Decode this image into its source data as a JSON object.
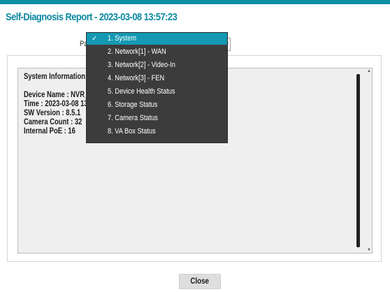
{
  "dialog": {
    "title": "Self-Diagnosis Report - 2023-03-08 13:57:23",
    "page_label": "Pa"
  },
  "dropdown": {
    "items": [
      {
        "label": "1. System",
        "selected": true
      },
      {
        "label": "2. Network[1] - WAN"
      },
      {
        "label": "3. Network[2] - Video-In"
      },
      {
        "label": "4. Network[3] - FEN"
      },
      {
        "label": "5. Device Health Status"
      },
      {
        "label": "6. Storage Status"
      },
      {
        "label": "7. Camera Status"
      },
      {
        "label": "8. VA Box Status"
      }
    ]
  },
  "content": {
    "heading": "System Information:",
    "lines": [
      "Device Name : NVR_WAN_0",
      "Time : 2023-03-08 13:57:23",
      "SW Version : 8.5.1",
      "Camera Count : 32",
      "Internal PoE : 16"
    ]
  },
  "footer": {
    "close_label": "Close"
  },
  "colors": {
    "accent": "#0f8ea4",
    "title": "#0c8aa0",
    "dropdown_bg": "#3c3c3c",
    "dropdown_selected": "#1599b3"
  },
  "icons": {
    "check": "check-icon",
    "scroll_up": "scroll-up-arrow-icon",
    "scroll_down": "scroll-down-arrow-icon",
    "select_arrow": "chevron-down-icon"
  }
}
